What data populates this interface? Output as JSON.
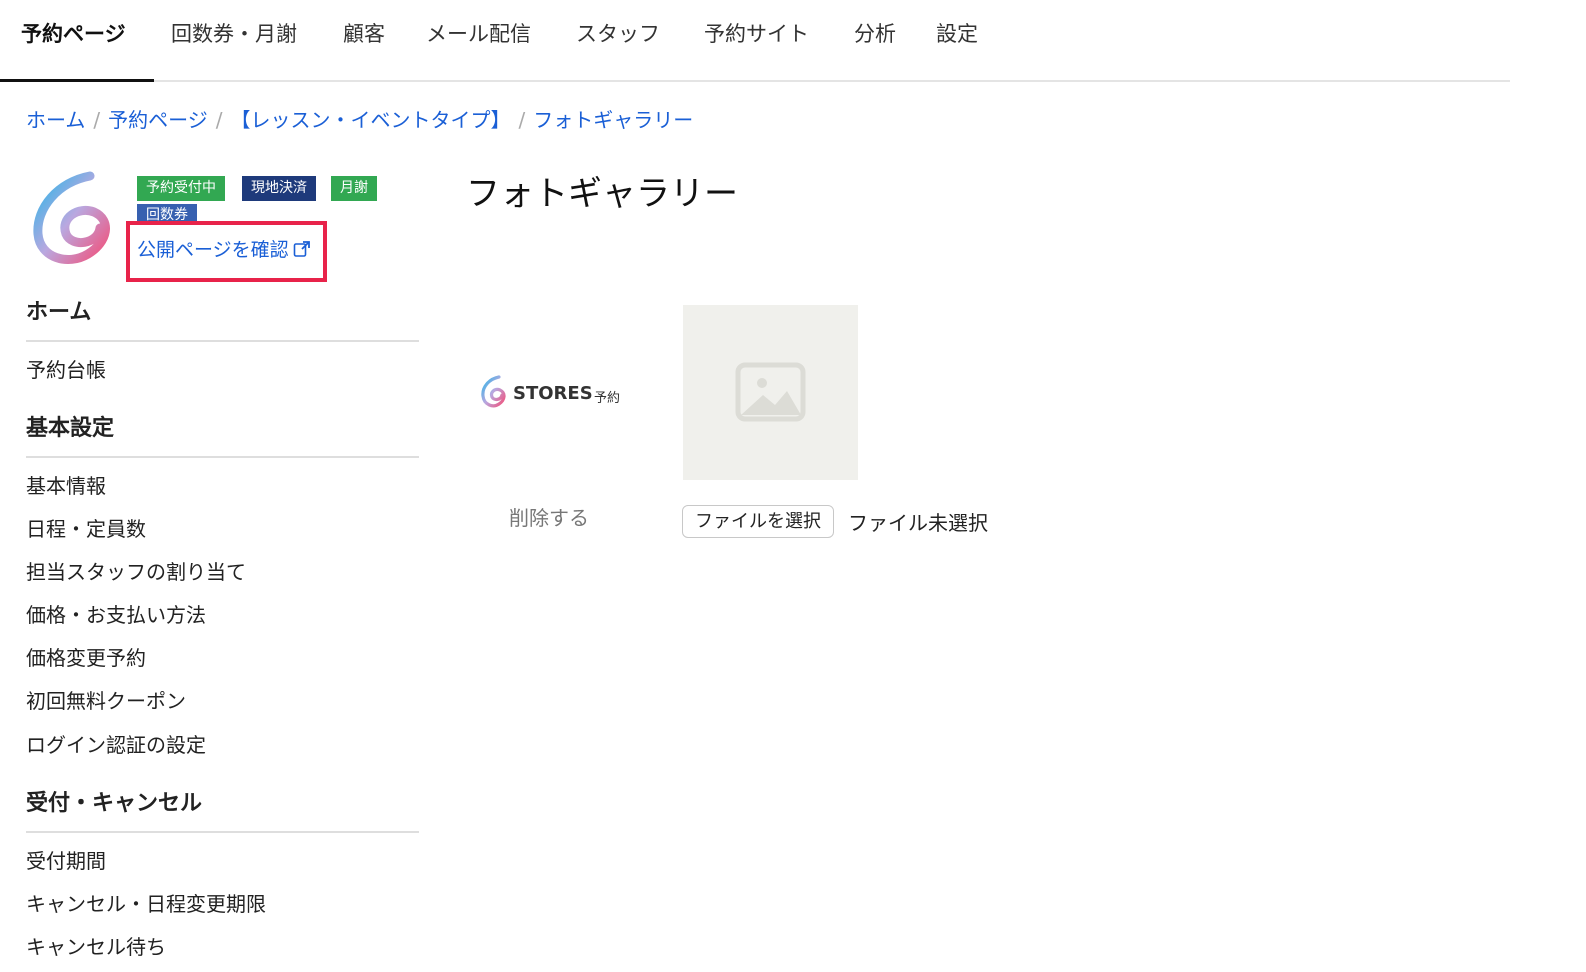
{
  "topnav": {
    "tabs": [
      {
        "label": "予約ページ",
        "active": true
      },
      {
        "label": "回数券・月謝",
        "active": false
      },
      {
        "label": "顧客",
        "active": false
      },
      {
        "label": "メール配信",
        "active": false
      },
      {
        "label": "スタッフ",
        "active": false
      },
      {
        "label": "予約サイト",
        "active": false
      },
      {
        "label": "分析",
        "active": false
      },
      {
        "label": "設定",
        "active": false
      }
    ]
  },
  "breadcrumb": {
    "items": [
      "ホーム",
      "予約ページ",
      "【レッスン・イベントタイプ】",
      "フォトギャラリー"
    ],
    "separator": "/"
  },
  "page": {
    "logo_icon": "stores-swirl-logo-icon",
    "badges": [
      {
        "label": "予約受付中",
        "color": "#32a852"
      },
      {
        "label": "現地決済",
        "color": "#1e3a7b"
      },
      {
        "label": "月謝",
        "color": "#32a852"
      },
      {
        "label": "回数券",
        "color": "#3760b0"
      }
    ],
    "public_link": "公開ページを確認",
    "highlight_color": "#e8234a"
  },
  "sidebar": {
    "sections": [
      {
        "heading": "ホーム",
        "items": [
          "予約台帳"
        ]
      },
      {
        "heading": "基本設定",
        "items": [
          "基本情報",
          "日程・定員数",
          "担当スタッフの割り当て",
          "価格・お支払い方法",
          "価格変更予約",
          "初回無料クーポン",
          "ログイン認証の設定"
        ]
      },
      {
        "heading": "受付・キャンセル",
        "items": [
          "受付期間",
          "キャンセル・日程変更期限",
          "キャンセル待ち"
        ]
      }
    ]
  },
  "main": {
    "title": "フォトギャラリー",
    "gallery": {
      "brand_word": "STORES",
      "brand_sub": "予約",
      "delete_label": "削除する",
      "placeholder_icon": "image-placeholder-icon",
      "file_button_label": "ファイルを選択",
      "file_status": "ファイル未選択"
    }
  },
  "colors": {
    "link": "#1a5fd6",
    "nav_border": "#e4e4e4"
  }
}
